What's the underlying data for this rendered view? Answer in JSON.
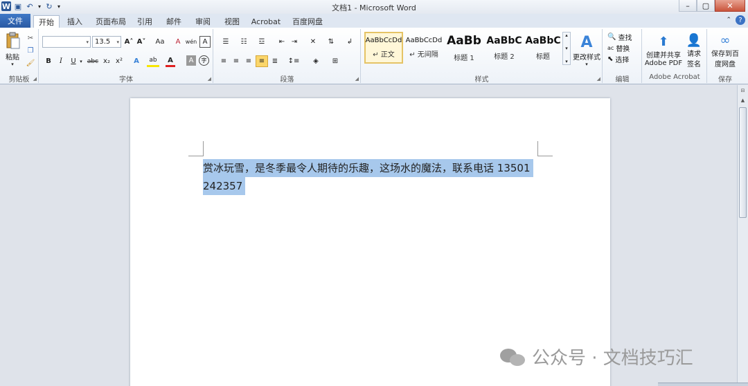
{
  "window": {
    "title": "文档1 - Microsoft Word",
    "controls": [
      "–",
      "▢",
      "✕"
    ]
  },
  "qat": {
    "logo": "W",
    "save": "💾",
    "undo": "↶",
    "redo": "↻",
    "more": "▾"
  },
  "tabs": [
    "文件",
    "开始",
    "插入",
    "页面布局",
    "引用",
    "邮件",
    "审阅",
    "视图",
    "Acrobat",
    "百度网盘"
  ],
  "ribbon": {
    "clipboard": {
      "paste": "粘贴",
      "label": "剪贴板"
    },
    "font": {
      "font_name": "",
      "font_size": "13.5",
      "grow": "A˄",
      "shrink": "A˅",
      "case": "Aa",
      "clear": "A",
      "pinyin": "wén",
      "border_char": "A",
      "bold": "B",
      "italic": "I",
      "underline": "U",
      "strike": "abc",
      "sub": "x₂",
      "sup": "x²",
      "effects": "A",
      "highlight": "ab",
      "color": "A",
      "shade": "A",
      "enclose": "字",
      "label": "字体"
    },
    "paragraph": {
      "label": "段落"
    },
    "styles": {
      "items": [
        {
          "sample": "AaBbCcDd",
          "name": "↵ 正文"
        },
        {
          "sample": "AaBbCcDd",
          "name": "↵ 无间隔"
        },
        {
          "sample": "AaBb",
          "name": "标题 1"
        },
        {
          "sample": "AaBbC",
          "name": "标题 2"
        },
        {
          "sample": "AaBbC",
          "name": "标题"
        }
      ],
      "change": "更改样式",
      "label": "样式"
    },
    "editing": {
      "find": "查找",
      "replace": "替换",
      "select": "选择",
      "label": "编辑"
    },
    "acrobat": {
      "create": "创建并共享",
      "create2": "Adobe PDF",
      "request": "请求",
      "request2": "签名",
      "label": "Adobe Acrobat"
    },
    "save": {
      "button": "保存到百",
      "button2": "度网盘",
      "label": "保存"
    }
  },
  "document": {
    "line1": "赏冰玩雪，是冬季最令人期待的乐趣，这场水的魔法，联系电话 13501",
    "line2": "242357"
  },
  "watermark": {
    "text": "公众号 · 文档技巧汇"
  },
  "colors": {
    "selection": "#a7c8ec",
    "file_tab": "#2a5aa3",
    "accent": "#3b72c4"
  }
}
